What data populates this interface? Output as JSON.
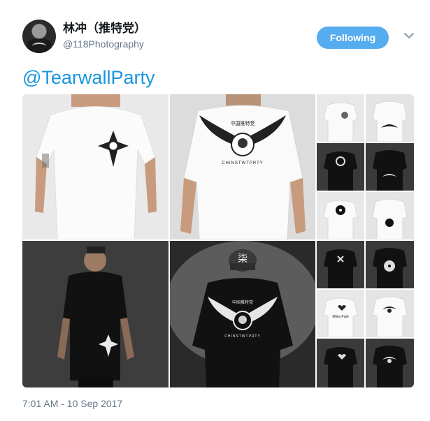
{
  "tweet": {
    "display_name": "林冲（推特党）",
    "handle": "@118Photography",
    "follow_label": "Following",
    "mention": "@TearwallParty",
    "timestamp": "7:01 AM - 10 Sep 2017"
  },
  "photos": {
    "back_print_text_white": "中国推特党",
    "back_print_arc_white": "CHINSTWTPRTY",
    "back_print_text_black": "中国推特党",
    "back_print_arc_black": "CHINSTWTPRTY",
    "cap_glyph": "柒",
    "heart_tee_text": "Miles Path"
  },
  "colors": {
    "accent": "#55acee",
    "link": "#1b95e0",
    "muted": "#657786"
  }
}
